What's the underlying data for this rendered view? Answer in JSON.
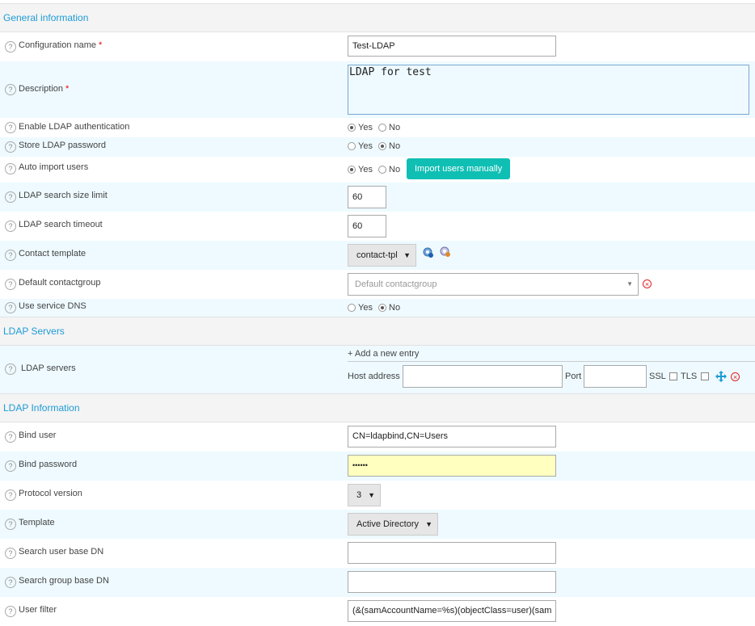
{
  "sections": {
    "general": "General information",
    "servers": "LDAP Servers",
    "info": "LDAP Information"
  },
  "help_glyph": "?",
  "required_mark": "*",
  "fields": {
    "config_name": {
      "label": "Configuration name",
      "value": "Test-LDAP"
    },
    "description": {
      "label": "Description",
      "value": "LDAP for test"
    },
    "enable_auth": {
      "label": "Enable LDAP authentication",
      "selected": "Yes"
    },
    "store_pwd": {
      "label": "Store LDAP password",
      "selected": "No"
    },
    "auto_import": {
      "label": "Auto import users",
      "selected": "Yes",
      "button": "Import users manually"
    },
    "size_limit": {
      "label": "LDAP search size limit",
      "value": "60"
    },
    "timeout": {
      "label": "LDAP search timeout",
      "value": "60"
    },
    "contact_template": {
      "label": "Contact template",
      "value": "contact-tpl"
    },
    "default_group": {
      "label": "Default contactgroup",
      "placeholder": "Default contactgroup"
    },
    "service_dns": {
      "label": "Use service DNS",
      "selected": "No"
    },
    "ldap_servers": {
      "label": "LDAP servers",
      "add_entry": "+ Add a new entry",
      "host_label": "Host address",
      "port_label": "Port",
      "ssl_label": "SSL",
      "tls_label": "TLS"
    },
    "bind_user": {
      "label": "Bind user",
      "value": "CN=ldapbind,CN=Users"
    },
    "bind_password": {
      "label": "Bind password",
      "value": "••••••"
    },
    "protocol": {
      "label": "Protocol version",
      "value": "3"
    },
    "template": {
      "label": "Template",
      "value": "Active Directory"
    },
    "user_base_dn": {
      "label": "Search user base DN",
      "value": ""
    },
    "group_base_dn": {
      "label": "Search group base DN",
      "value": ""
    },
    "user_filter": {
      "label": "User filter",
      "value": "(&(samAccountName=%s)(objectClass=user)(sam"
    }
  },
  "radio": {
    "yes": "Yes",
    "no": "No"
  },
  "select_arrow": "▼",
  "colors": {
    "section_title": "#1e9bd7",
    "alt_row": "#eefaff",
    "button": "#10bfb4",
    "password_bg": "#ffffc0"
  }
}
